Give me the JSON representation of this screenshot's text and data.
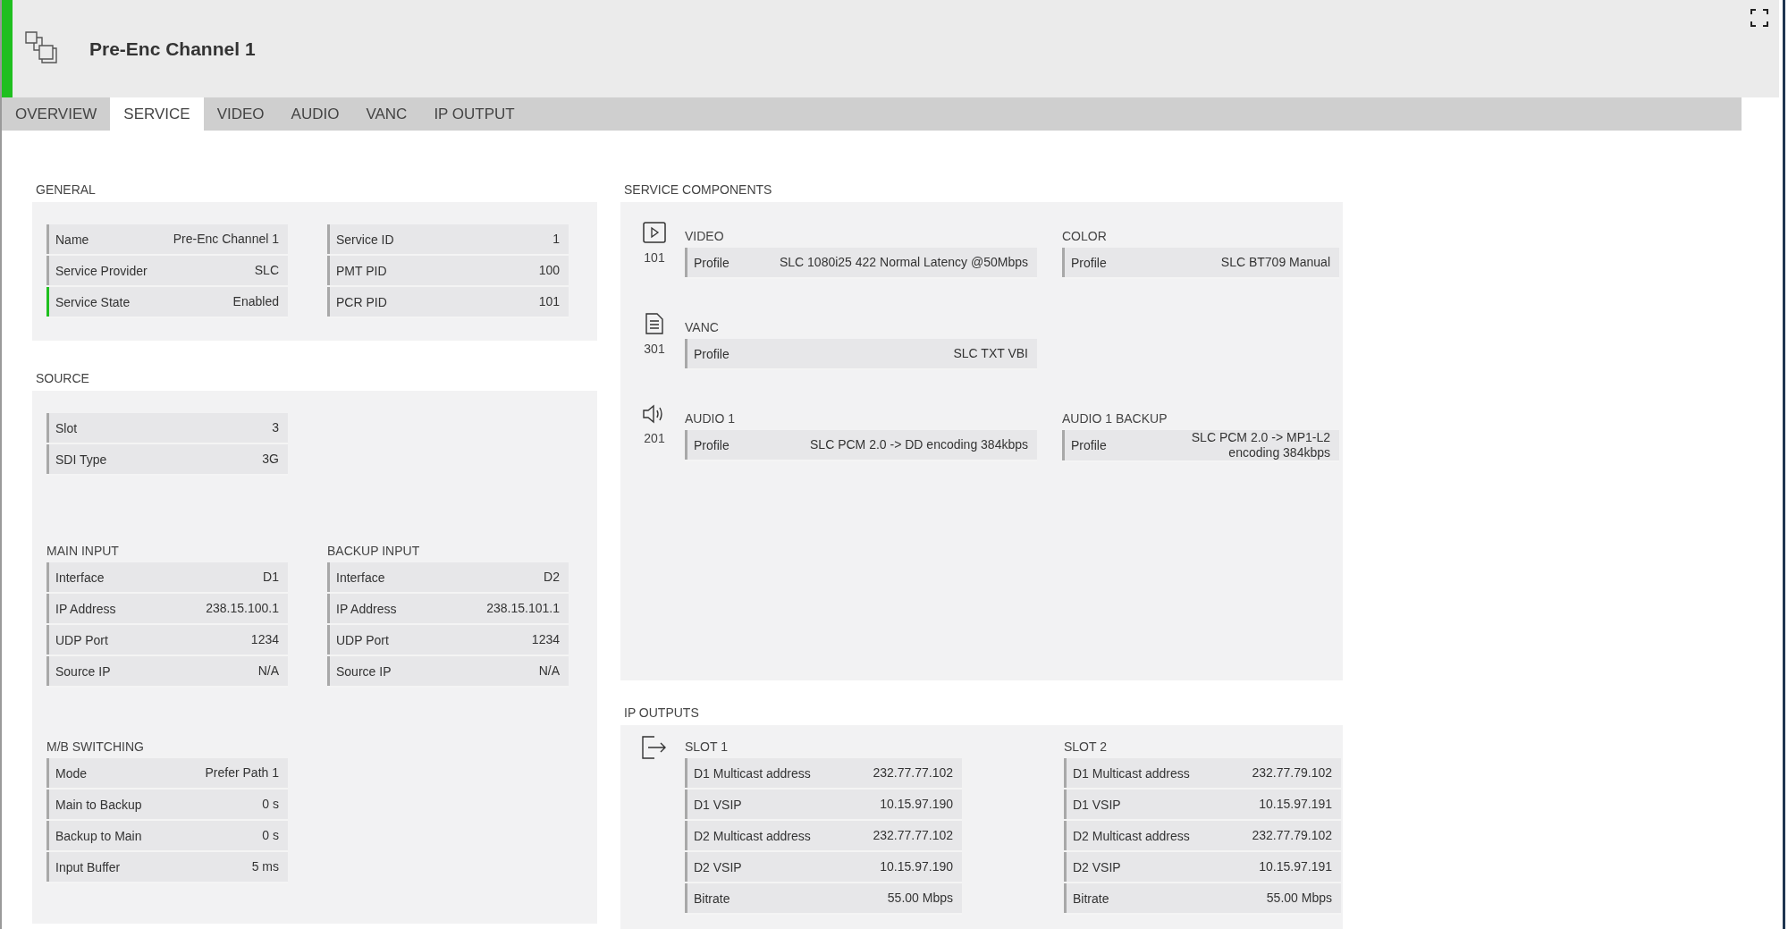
{
  "header": {
    "title": "Pre-Enc Channel 1",
    "online": true
  },
  "tabs": [
    {
      "label": "OVERVIEW",
      "selected": false
    },
    {
      "label": "SERVICE",
      "selected": true
    },
    {
      "label": "VIDEO",
      "selected": false
    },
    {
      "label": "AUDIO",
      "selected": false
    },
    {
      "label": "VANC",
      "selected": false
    },
    {
      "label": "IP OUTPUT",
      "selected": false
    }
  ],
  "general": {
    "title": "GENERAL",
    "tables": [
      [
        {
          "label": "Name",
          "value": "Pre-Enc Channel 1"
        },
        {
          "label": "Service Provider",
          "value": "SLC"
        },
        {
          "label": "Service State",
          "value": "Enabled",
          "color": "#1fbf1f"
        }
      ],
      [
        {
          "label": "Service ID",
          "value": "1"
        },
        {
          "label": "PMT PID",
          "value": "100"
        },
        {
          "label": "PCR PID",
          "value": "101"
        }
      ]
    ]
  },
  "source": {
    "title": "SOURCE",
    "rows": [
      {
        "label": "Slot",
        "value": "3"
      },
      {
        "label": "SDI Type",
        "value": "3G"
      }
    ],
    "inputs": [
      {
        "title": "MAIN INPUT",
        "rows": [
          {
            "label": "Interface",
            "value": "D1"
          },
          {
            "label": "IP Address",
            "value": "238.15.100.1"
          },
          {
            "label": "UDP Port",
            "value": "1234"
          },
          {
            "label": "Source IP",
            "value": "N/A"
          }
        ]
      },
      {
        "title": "BACKUP INPUT",
        "rows": [
          {
            "label": "Interface",
            "value": "D2"
          },
          {
            "label": "IP Address",
            "value": "238.15.101.1"
          },
          {
            "label": "UDP Port",
            "value": "1234"
          },
          {
            "label": "Source IP",
            "value": "N/A"
          }
        ]
      }
    ],
    "switching": {
      "title": "M/B SWITCHING",
      "rows": [
        {
          "label": "Mode",
          "value": "Prefer Path 1"
        },
        {
          "label": "Main to Backup",
          "value": "0 s"
        },
        {
          "label": "Backup to Main",
          "value": "0 s"
        },
        {
          "label": "Input Buffer",
          "value": "5 ms"
        }
      ]
    }
  },
  "service_components": {
    "title": "SERVICE COMPONENTS",
    "components": [
      {
        "kind": "video",
        "id": "101",
        "title": "VIDEO",
        "rows": [
          {
            "label": "Profile",
            "value": "SLC 1080i25 422 Normal Latency @50Mbps"
          }
        ],
        "side": {
          "title": "COLOR",
          "rows": [
            {
              "label": "Profile",
              "value": "SLC BT709 Manual"
            }
          ]
        }
      },
      {
        "kind": "vanc",
        "id": "301",
        "title": "VANC",
        "rows": [
          {
            "label": "Profile",
            "value": "SLC TXT VBI"
          }
        ]
      },
      {
        "kind": "audio",
        "id": "201",
        "title": "AUDIO 1",
        "rows": [
          {
            "label": "Profile",
            "value": "SLC PCM 2.0 -> DD encoding 384kbps"
          }
        ],
        "side": {
          "title": "AUDIO 1 BACKUP",
          "rows": [
            {
              "label": "Profile",
              "value": "SLC PCM 2.0 -> MP1-L2 encoding 384kbps"
            }
          ]
        }
      }
    ]
  },
  "ip_outputs": {
    "title": "IP OUTPUTS",
    "slots": [
      {
        "title": "SLOT 1",
        "rows": [
          {
            "label": "D1 Multicast address",
            "value": "232.77.77.102"
          },
          {
            "label": "D1 VSIP",
            "value": "10.15.97.190"
          },
          {
            "label": "D2 Multicast address",
            "value": "232.77.77.102"
          },
          {
            "label": "D2 VSIP",
            "value": "10.15.97.190"
          },
          {
            "label": "Bitrate",
            "value": "55.00 Mbps"
          }
        ]
      },
      {
        "title": "SLOT 2",
        "rows": [
          {
            "label": "D1 Multicast address",
            "value": "232.77.79.102"
          },
          {
            "label": "D1 VSIP",
            "value": "10.15.97.191"
          },
          {
            "label": "D2 Multicast address",
            "value": "232.77.79.102"
          },
          {
            "label": "D2 VSIP",
            "value": "10.15.97.191"
          },
          {
            "label": "Bitrate",
            "value": "55.00 Mbps"
          }
        ]
      }
    ]
  }
}
